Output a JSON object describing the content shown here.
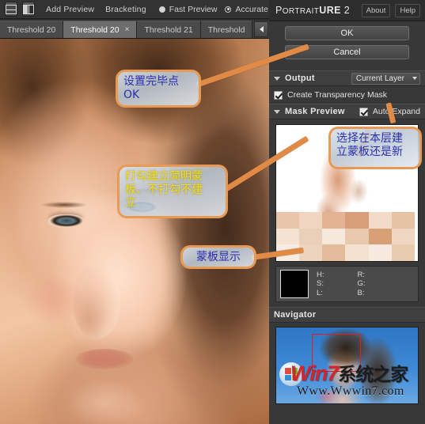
{
  "app": {
    "brand_small": "ORTRAIT",
    "brand_p": "P",
    "brand_bold": "URE",
    "brand_num": "2",
    "about_label": "About",
    "help_label": "Help"
  },
  "toolbar": {
    "icons": [
      "split-horizontal-icon",
      "split-vertical-icon"
    ],
    "add_preview_label": "Add Preview",
    "bracketing_label": "Bracketing",
    "fast_preview_label": "Fast Preview",
    "accurate_label": "Accurate",
    "selected_quality": "Fast Preview"
  },
  "tabs": {
    "items": [
      {
        "label": "Threshold 20",
        "active": false,
        "closable": false
      },
      {
        "label": "Threshold 20",
        "active": true,
        "closable": true,
        "close_glyph": "×"
      },
      {
        "label": "Threshold 21",
        "active": false,
        "closable": false
      },
      {
        "label": "Threshold",
        "active": false,
        "closable": false
      }
    ],
    "nav_prev": "prev-tab-icon",
    "nav_next": "next-tab-icon",
    "nav_menu": "tab-menu-icon"
  },
  "actions": {
    "ok_label": "OK",
    "cancel_label": "Cancel"
  },
  "output": {
    "title": "Output",
    "target_value": "Current Layer",
    "transparency_mask_label": "Create Transparency Mask",
    "transparency_mask_checked": true
  },
  "mask_preview": {
    "title": "Mask Preview",
    "auto_expand_label": "Auto Expand",
    "auto_expand_checked": true
  },
  "color_readout": {
    "swatch_hex": "#000000",
    "h_label": "H:",
    "s_label": "S:",
    "l_label": "L:",
    "r_label": "R:",
    "g_label": "G:",
    "b_label": "B:",
    "h_value": "",
    "s_value": "",
    "l_value": "",
    "r_value": "",
    "g_value": "",
    "b_value": ""
  },
  "navigator": {
    "title": "Navigator",
    "viewbox_color": "#e02020"
  },
  "watermark": {
    "win_text": "Win7",
    "cn_text": "系统之家",
    "url": "Www.Wwwin7.com",
    "logo": "windows-logo-icon"
  },
  "annotations": [
    {
      "id": "co-ok",
      "text": "设置完毕点\nOK",
      "color": "blue"
    },
    {
      "id": "co-chk",
      "text": "打勾建立简明蒙\n板、不打勾不建\n立",
      "color": "yellow"
    },
    {
      "id": "co-mask",
      "text": "蒙板显示",
      "color": "blue"
    },
    {
      "id": "co-layer",
      "text": "选择在本层建\n立蒙板还是新",
      "color": "blue"
    }
  ],
  "colors": {
    "accent_orange": "#e89a55",
    "panel_bg": "#383838",
    "toolbar_bg": "#333333",
    "text": "#e2e2e2",
    "annotation_blue": "#2b2fb0",
    "annotation_yellow": "#f2e014",
    "watermark_red": "#d8232a"
  }
}
